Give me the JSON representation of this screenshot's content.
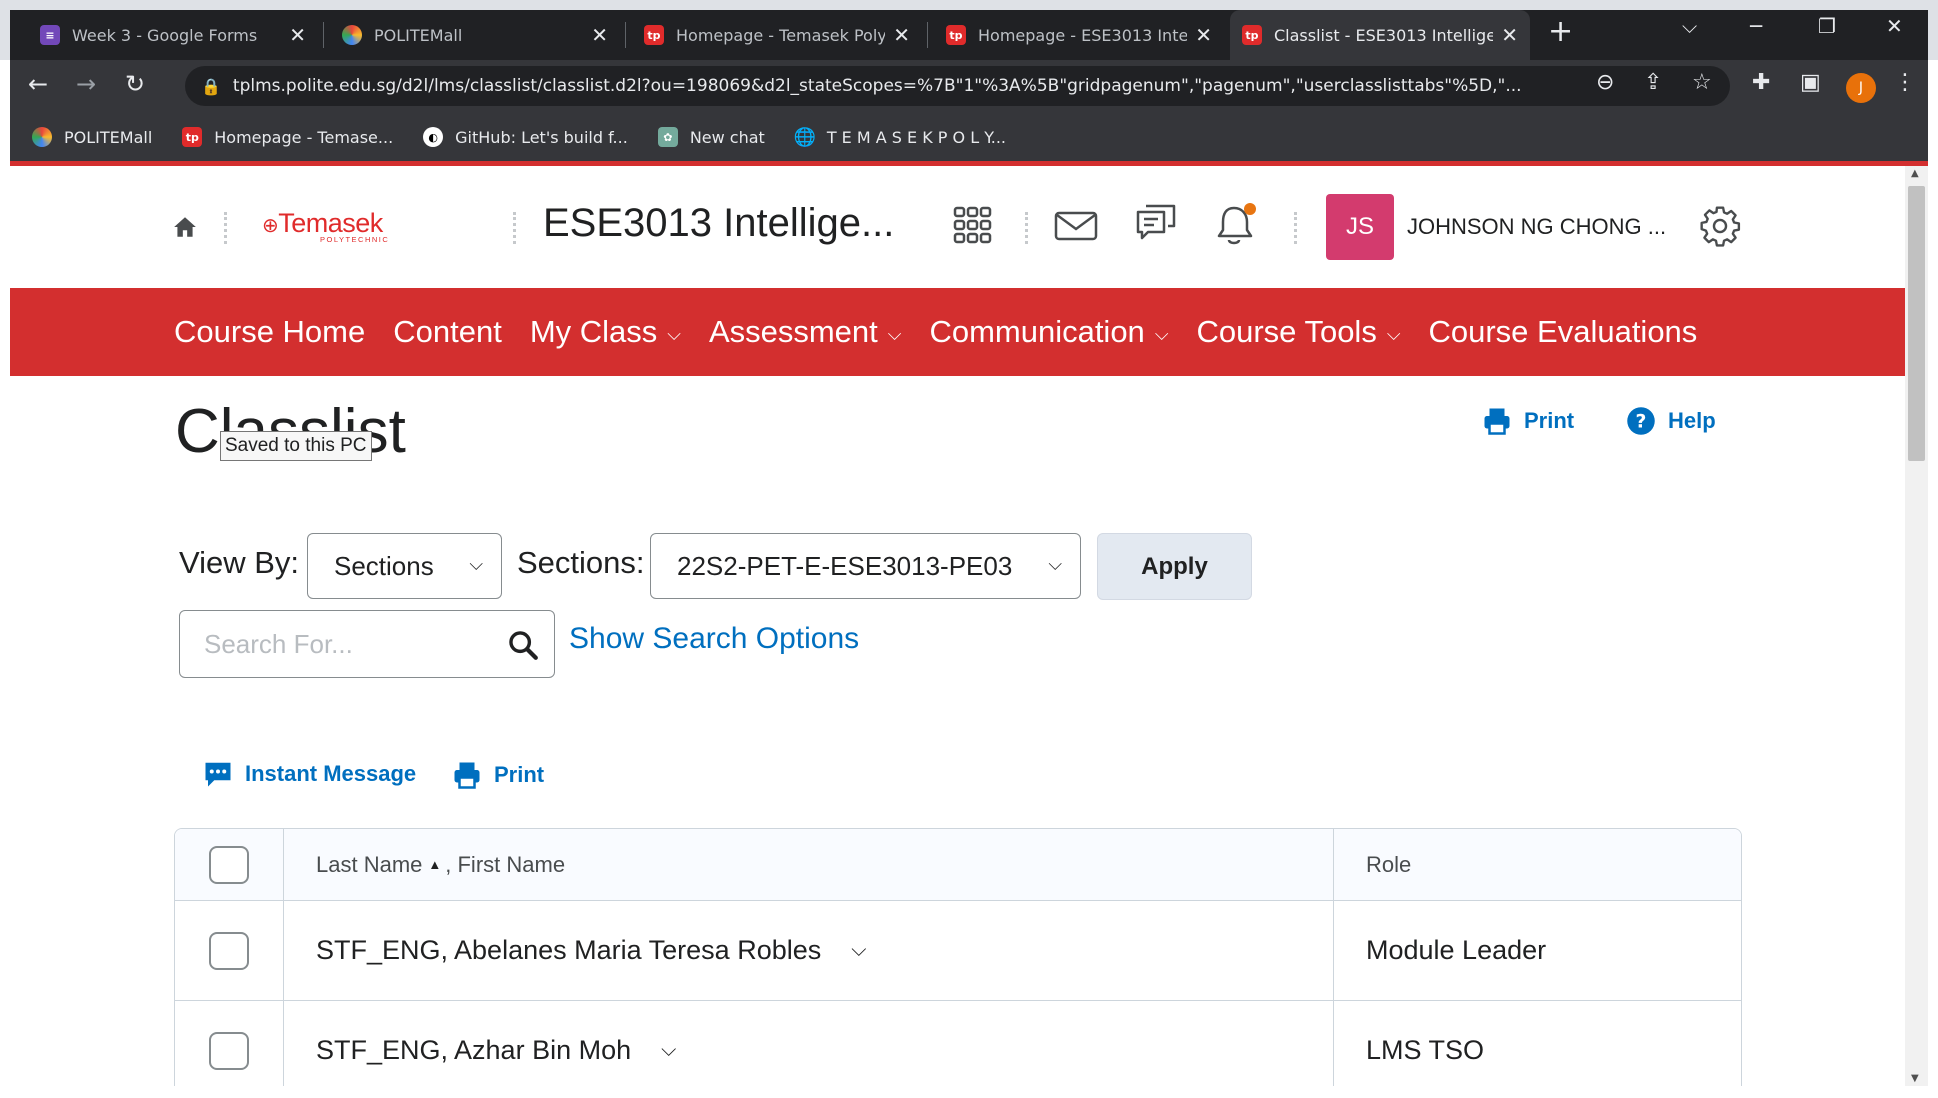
{
  "browser": {
    "tabs": [
      {
        "title": "Week 3 - Google Forms",
        "icon": "google-forms-icon",
        "color": "#7248b9"
      },
      {
        "title": "POLITEMall",
        "icon": "politemall-icon",
        "color": "#e8453c"
      },
      {
        "title": "Homepage - Temasek Polytechnic",
        "icon": "tp-icon",
        "color": "#e02b2b"
      },
      {
        "title": "Homepage - ESE3013 Intelligent",
        "icon": "tp-icon",
        "color": "#e02b2b"
      },
      {
        "title": "Classlist - ESE3013 Intelligent",
        "icon": "tp-icon",
        "color": "#e02b2b",
        "active": true
      }
    ],
    "new_tab": "+",
    "url": "tplms.polite.edu.sg/d2l/lms/classlist/classlist.d2l?ou=198069&d2l_stateScopes=%7B\"1\"%3A%5B\"gridpagenum\",\"pagenum\",\"userclasslisttabs\"%5D,\"...",
    "bookmarks": [
      {
        "label": "POLITEMall",
        "icon": "politemall-icon",
        "color": "#e8453c"
      },
      {
        "label": "Homepage - Temase...",
        "icon": "tp-icon",
        "color": "#e02b2b"
      },
      {
        "label": "GitHub: Let's build f...",
        "icon": "github-icon",
        "color": "#ffffff"
      },
      {
        "label": "New chat",
        "icon": "chatgpt-icon",
        "color": "#74aa9c"
      },
      {
        "label": "T E M A S E K P O L Y...",
        "icon": "globe-icon",
        "color": "#e8eaed"
      }
    ],
    "profile_initial": "J"
  },
  "header": {
    "logo_name": "Temasek",
    "logo_sub": "POLYTECHNIC",
    "course_title": "ESE3013 Intellige...",
    "avatar_initials": "JS",
    "username": "JOHNSON NG CHONG ...",
    "notification_dot_color": "#e87511"
  },
  "nav": {
    "items": [
      {
        "label": "Course Home",
        "dropdown": false
      },
      {
        "label": "Content",
        "dropdown": false
      },
      {
        "label": "My Class",
        "dropdown": true
      },
      {
        "label": "Assessment",
        "dropdown": true
      },
      {
        "label": "Communication",
        "dropdown": true
      },
      {
        "label": "Course Tools",
        "dropdown": true
      },
      {
        "label": "Course Evaluations",
        "dropdown": false
      }
    ],
    "bg_color": "#d32f2f"
  },
  "page": {
    "title": "Classlist",
    "tooltip": "Saved to this PC",
    "print_label": "Print",
    "help_label": "Help",
    "view_by_label": "View By:",
    "view_by_value": "Sections",
    "sections_label": "Sections:",
    "sections_value": "22S2-PET-E-ESE3013-PE03",
    "apply_label": "Apply",
    "search_placeholder": "Search For...",
    "show_search_options": "Show Search Options",
    "instant_message_label": "Instant Message",
    "print2_label": "Print",
    "link_color": "#006fbf"
  },
  "table": {
    "col_name_last": "Last Name",
    "col_name_first": ", First Name",
    "col_role": "Role",
    "rows": [
      {
        "name": "STF_ENG, Abelanes Maria Teresa Robles",
        "role": "Module Leader"
      },
      {
        "name": "STF_ENG, Azhar Bin Moh",
        "role": "LMS TSO"
      }
    ]
  }
}
